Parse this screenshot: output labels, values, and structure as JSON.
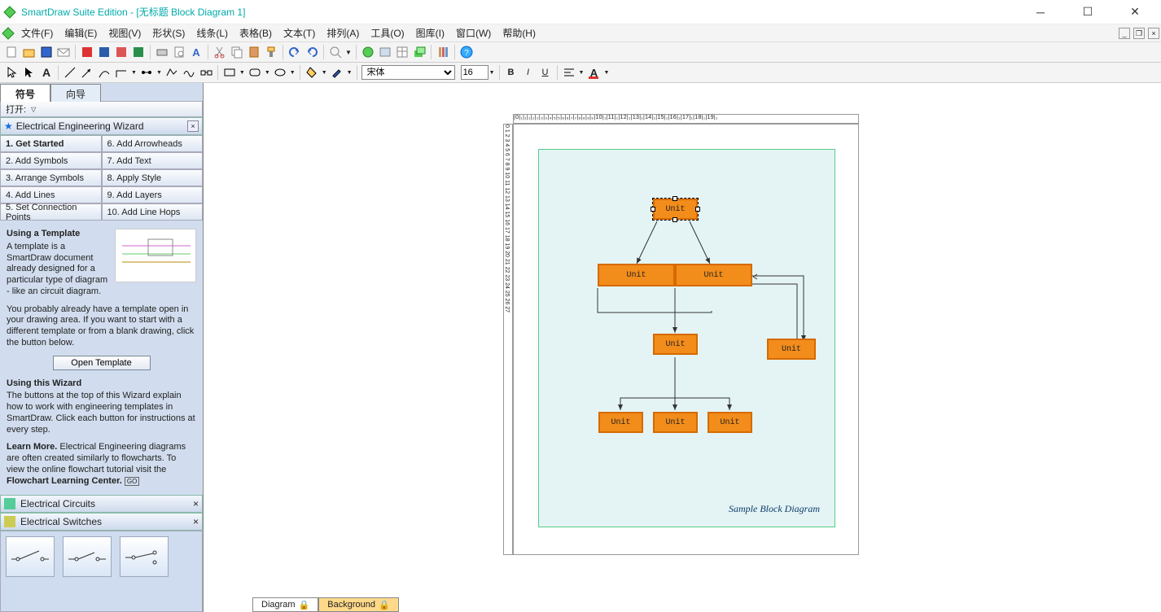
{
  "title": "SmartDraw Suite Edition - [无标题 Block Diagram 1]",
  "menu": [
    "文件(F)",
    "编辑(E)",
    "视图(V)",
    "形状(S)",
    "线条(L)",
    "表格(B)",
    "文本(T)",
    "排列(A)",
    "工具(O)",
    "图库(I)",
    "窗口(W)",
    "帮助(H)"
  ],
  "font": {
    "family": "宋体",
    "size": "16"
  },
  "sidebar": {
    "tab1": "符号",
    "tab2": "向导",
    "open": "打开:",
    "panel_title": "Electrical Engineering Wizard",
    "steps": [
      "1. Get Started",
      "6. Add Arrowheads",
      "2. Add Symbols",
      "7. Add Text",
      "3. Arrange Symbols",
      "8. Apply Style",
      "4. Add Lines",
      "9. Add Layers",
      "5. Set Connection Points",
      "10. Add Line Hops"
    ],
    "h1": "Using a Template",
    "p1": "A template is a SmartDraw document already designed for a particular type of diagram - like an circuit diagram.",
    "p2": "You probably already have a template open in your drawing area. If you want to start with a different template or from a blank drawing, click the button below.",
    "btn": "Open Template",
    "h2": "Using this Wizard",
    "p3": "The buttons at the top of this Wizard explain how to work with engineering templates in SmartDraw. Click each button for instructions at every step.",
    "lm": "Learn More.",
    "p4": " Electrical Engineering diagrams are often created similarly to flowcharts. To view the online flowchart tutorial visit the ",
    "flc": "Flowchart Learning Center.",
    "go": "GO",
    "circuits": "Electrical Circuits",
    "switches": "Electrical Switches"
  },
  "diagram": {
    "unit": "Unit",
    "caption": "Sample Block Diagram"
  },
  "tabs": {
    "diagram": "Diagram",
    "background": "Background"
  },
  "ruler_h": "|0|₁|₁|₁|₂|₂|₃|₃|₄|₅|₅|₆|₆|₇|₇|₈|₈|₉|₉|10|₁|11|₁|12|₁|13|₁|14|₁|15|₁|16|₁|17|₁|18|₁|19|₁",
  "ruler_v": "0 1 2 3 4 5 6 7 8 9 10 11 12 13 14 15 16 17 18 19 20 21 22 23 24 25 26 27"
}
